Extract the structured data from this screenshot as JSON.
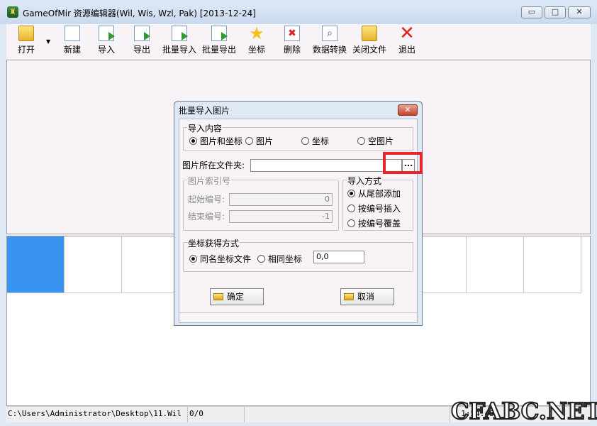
{
  "window": {
    "title": "GameOfMir 资源编辑器(Wil, Wis, Wzl, Pak) [2013-12-24]",
    "controls": {
      "minimize": "▭",
      "maximize": "□",
      "close": "✕"
    }
  },
  "toolbar": {
    "items": [
      {
        "label": "打开",
        "icon": "open-folder-icon"
      },
      {
        "label": "新建",
        "icon": "new-file-icon"
      },
      {
        "label": "导入",
        "icon": "import-icon"
      },
      {
        "label": "导出",
        "icon": "export-icon"
      },
      {
        "label": "批量导入",
        "icon": "batch-import-icon"
      },
      {
        "label": "批量导出",
        "icon": "batch-export-icon"
      },
      {
        "label": "坐标",
        "icon": "star-icon"
      },
      {
        "label": "删除",
        "icon": "delete-icon"
      },
      {
        "label": "数据转换",
        "icon": "convert-icon"
      },
      {
        "label": "关闭文件",
        "icon": "close-file-icon"
      },
      {
        "label": "退出",
        "icon": "exit-icon"
      }
    ]
  },
  "statusbar": {
    "path": "C:\\Users\\Administrator\\Desktop\\11.Wil",
    "count": "0/0",
    "extra": "1 1:54:48"
  },
  "watermark": "CFABC.NET",
  "dialog": {
    "title": "批量导入图片",
    "close": "✕",
    "import_content": {
      "legend": "导入内容",
      "options": [
        "图片和坐标",
        "图片",
        "坐标",
        "空图片"
      ],
      "selected": "图片和坐标"
    },
    "folder": {
      "label": "图片所在文件夹:",
      "value": "",
      "browse": "..."
    },
    "index_group": {
      "legend": "图片索引号",
      "start_label": "起始编号:",
      "start_value": "0",
      "end_label": "结束编号:",
      "end_value": "-1"
    },
    "import_mode": {
      "legend": "导入方式",
      "options": [
        "从尾部添加",
        "按编号插入",
        "按编号覆盖"
      ],
      "selected": "从尾部添加"
    },
    "coord_mode": {
      "legend": "坐标获得方式",
      "options": [
        "同名坐标文件",
        "相同坐标"
      ],
      "selected": "同名坐标文件",
      "value": "0,0"
    },
    "ok": "确定",
    "cancel": "取消"
  }
}
